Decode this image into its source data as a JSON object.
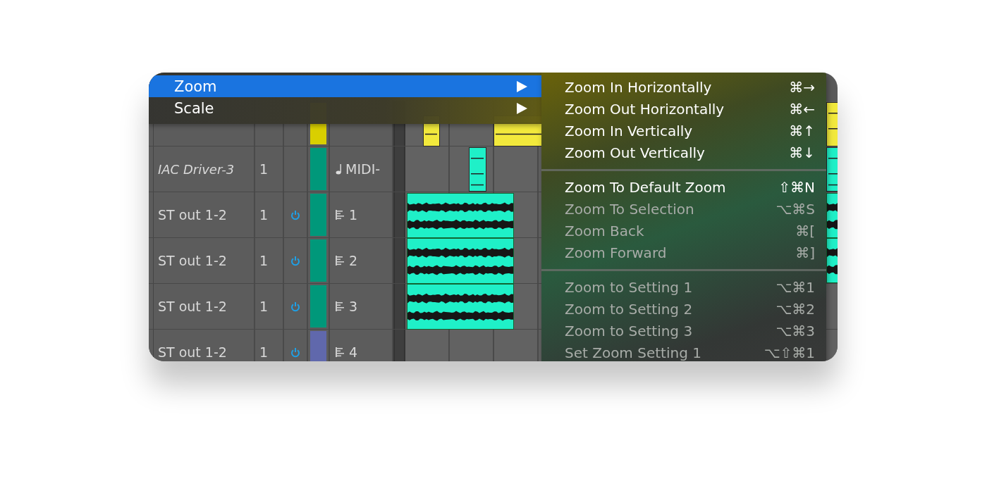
{
  "tracks": [
    {
      "kind": "midi",
      "color": "#d9cf00"
    },
    {
      "kind": "midi",
      "name": "IAC Driver-3",
      "channel": "1",
      "color": "#00987a",
      "output": "MIDI-"
    },
    {
      "kind": "audio",
      "name": "ST out 1-2",
      "channel": "1",
      "color": "#00987a",
      "output": "1"
    },
    {
      "kind": "audio",
      "name": "ST out 1-2",
      "channel": "1",
      "color": "#00987a",
      "output": "2"
    },
    {
      "kind": "audio",
      "name": "ST out 1-2",
      "channel": "1",
      "color": "#00987a",
      "output": "3"
    },
    {
      "kind": "audio",
      "name": "ST out 1-2",
      "channel": "1",
      "color": "#6068ac",
      "output": "4"
    }
  ],
  "menu": {
    "items": [
      {
        "label": "Zoom",
        "selected": true
      },
      {
        "label": "Scale",
        "selected": false
      }
    ]
  },
  "submenu": {
    "sections": [
      {
        "items": [
          {
            "label": "Zoom In Horizontally",
            "shortcut": "⌘→",
            "disabled": false
          },
          {
            "label": "Zoom Out Horizontally",
            "shortcut": "⌘←",
            "disabled": false
          },
          {
            "label": "Zoom In Vertically",
            "shortcut": "⌘↑",
            "disabled": false
          },
          {
            "label": "Zoom Out Vertically",
            "shortcut": "⌘↓",
            "disabled": false
          }
        ]
      },
      {
        "items": [
          {
            "label": "Zoom To Default Zoom",
            "shortcut": "⇧⌘N",
            "disabled": false
          },
          {
            "label": "Zoom To Selection",
            "shortcut": "⌥⌘S",
            "disabled": true
          },
          {
            "label": "Zoom Back",
            "shortcut": "⌘[",
            "disabled": true
          },
          {
            "label": "Zoom Forward",
            "shortcut": "⌘]",
            "disabled": true
          }
        ]
      },
      {
        "items": [
          {
            "label": "Zoom to Setting 1",
            "shortcut": "⌥⌘1",
            "disabled": true
          },
          {
            "label": "Zoom to Setting 2",
            "shortcut": "⌥⌘2",
            "disabled": true
          },
          {
            "label": "Zoom to Setting 3",
            "shortcut": "⌥⌘3",
            "disabled": true
          },
          {
            "label": "Set Zoom Setting 1",
            "shortcut": "⌥⇧⌘1",
            "disabled": true
          }
        ]
      }
    ]
  }
}
